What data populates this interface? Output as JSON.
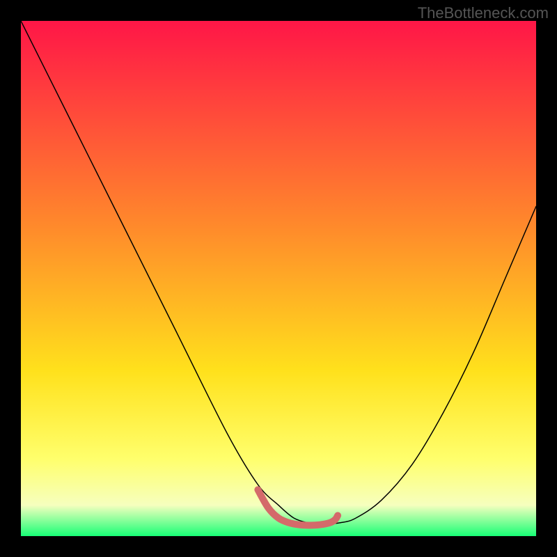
{
  "watermark": "TheBottleneck.com",
  "chart_data": {
    "type": "line",
    "title": "",
    "xlabel": "",
    "ylabel": "",
    "xlim": [
      0,
      100
    ],
    "ylim": [
      0,
      100
    ],
    "grid": false,
    "background_gradient": {
      "stops": [
        {
          "offset": 0,
          "color": "#ff1647"
        },
        {
          "offset": 40,
          "color": "#ff8a2b"
        },
        {
          "offset": 68,
          "color": "#ffe11c"
        },
        {
          "offset": 85,
          "color": "#ffff6c"
        },
        {
          "offset": 94,
          "color": "#f6ffbe"
        },
        {
          "offset": 100,
          "color": "#18ff76"
        }
      ]
    },
    "series": [
      {
        "name": "left-curve",
        "color": "#000000",
        "width": 1.5,
        "x": [
          0,
          10,
          20,
          30,
          40,
          46,
          50,
          53,
          56,
          58
        ],
        "y": [
          100,
          80,
          60,
          40,
          20,
          10,
          6,
          3.5,
          2.5,
          2.2
        ]
      },
      {
        "name": "right-curve",
        "color": "#000000",
        "width": 1.5,
        "x": [
          58,
          62,
          65,
          70,
          76,
          82,
          88,
          94,
          100
        ],
        "y": [
          2.2,
          2.6,
          3.5,
          7,
          14,
          24,
          36,
          50,
          64
        ]
      },
      {
        "name": "floor-band",
        "color": "#d46a6a",
        "width": 10,
        "x": [
          46,
          48,
          50,
          52,
          54,
          56,
          58,
          60,
          61,
          61.5
        ],
        "y": [
          9,
          5.5,
          3.5,
          2.6,
          2.2,
          2.1,
          2.2,
          2.6,
          3.2,
          4.0
        ]
      }
    ]
  }
}
